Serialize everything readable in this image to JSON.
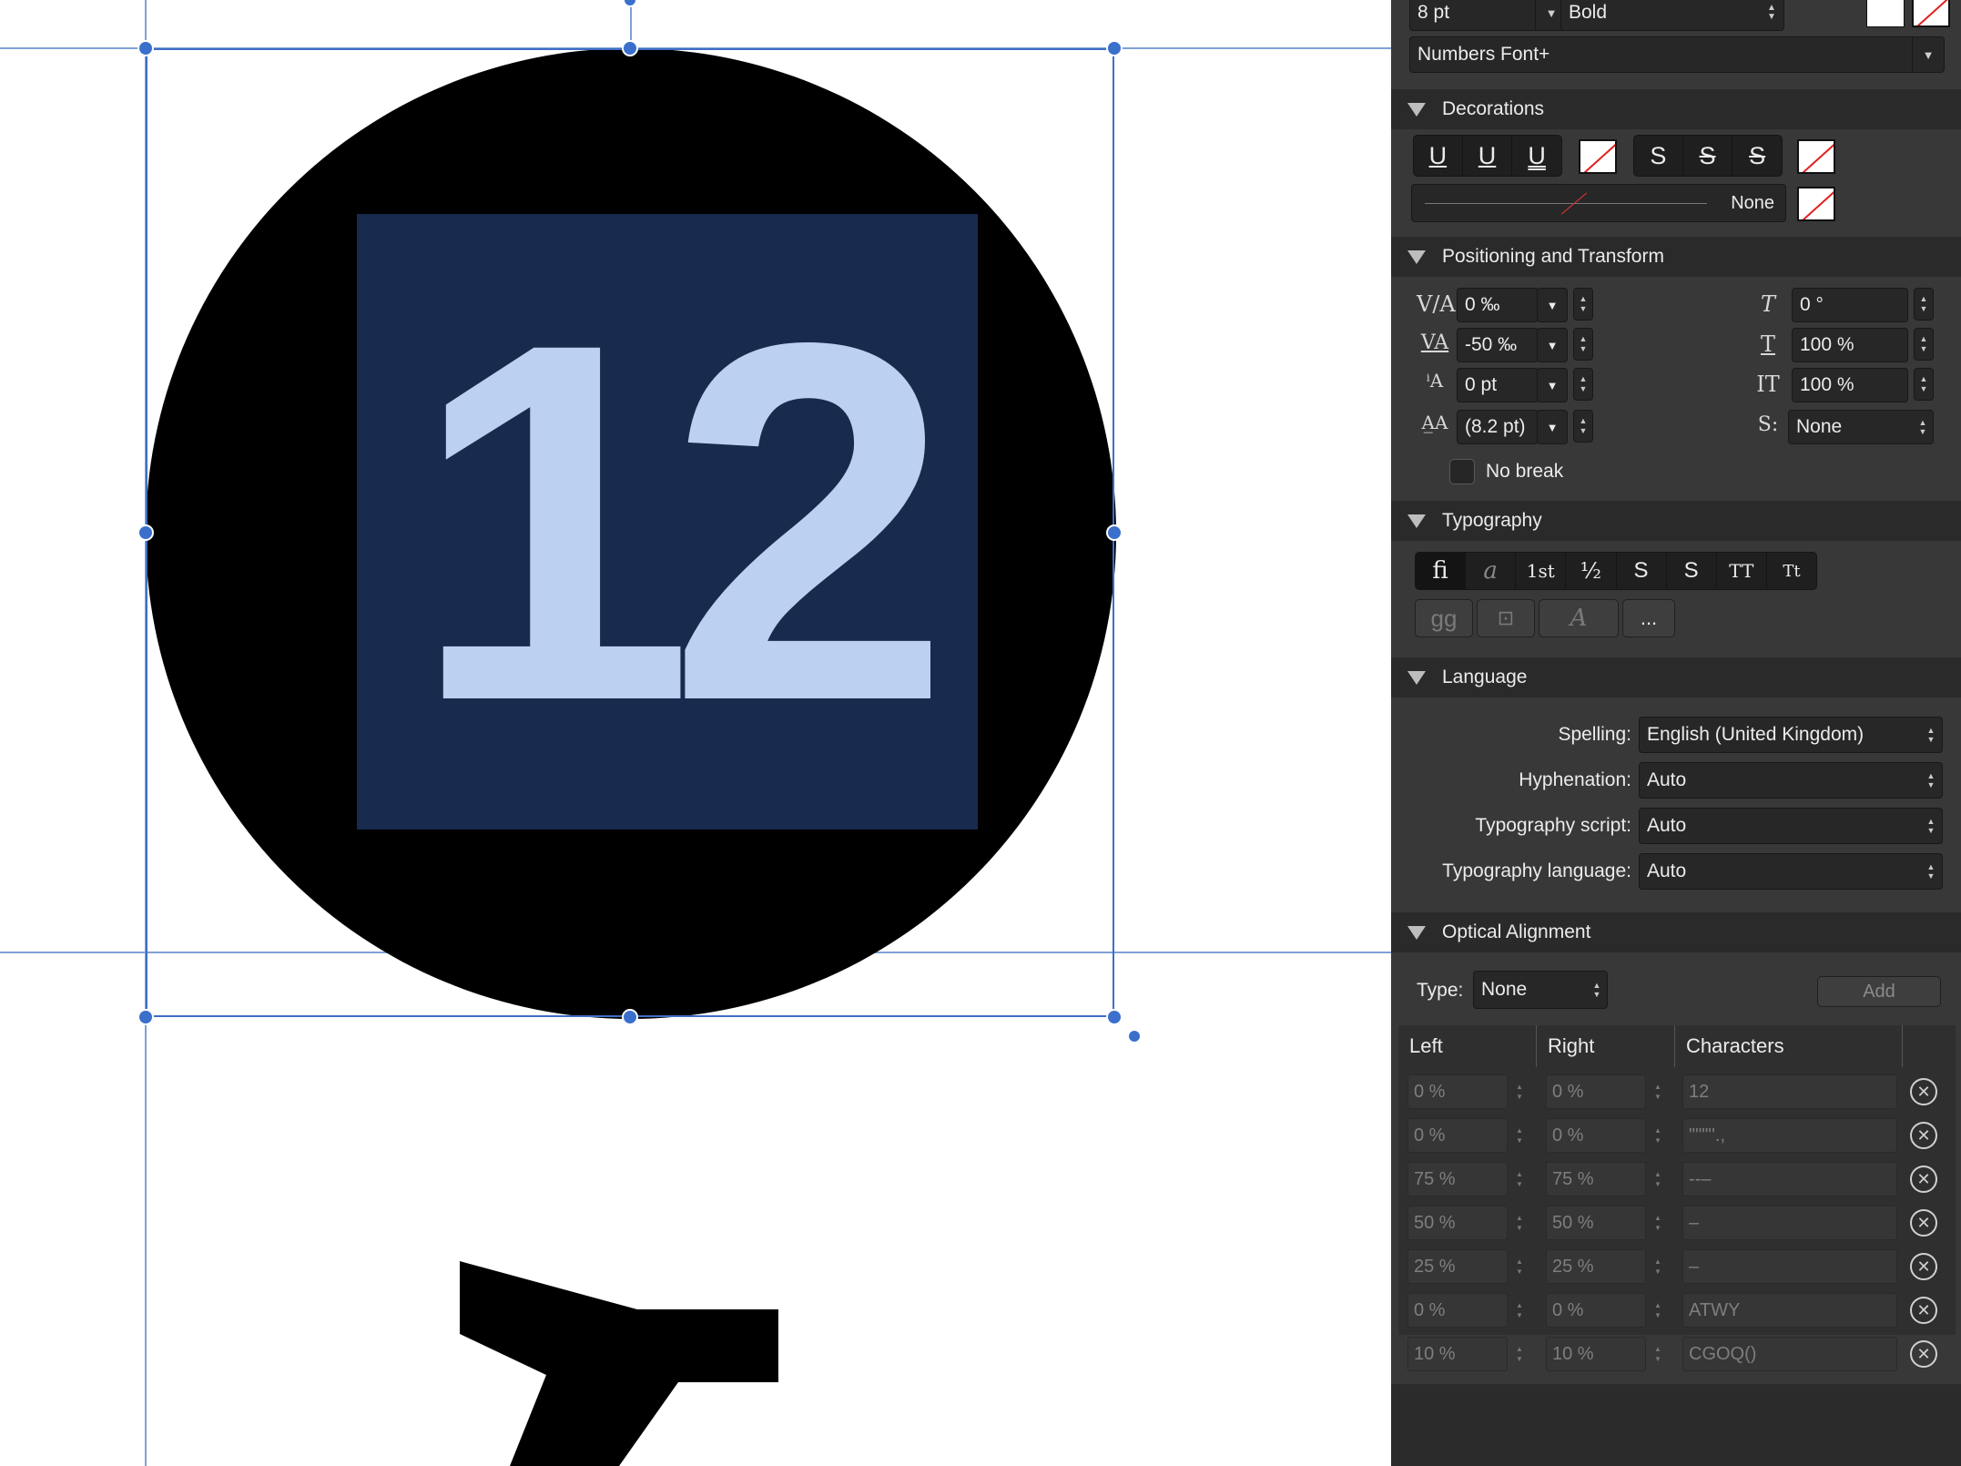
{
  "canvas": {
    "number_text": "12",
    "colors": {
      "circle": "#000000",
      "square": "#182a4d",
      "digits": "#bcd0f2",
      "guides": "#7fa0d6",
      "selection": "#3d6fc4"
    }
  },
  "panel": {
    "font_size": "8 pt",
    "font_weight": "Bold",
    "font_feature": "Numbers Font+",
    "decorations": {
      "title": "Decorations",
      "underline_buttons": [
        "U",
        "U",
        "U"
      ],
      "strike_buttons": [
        "S",
        "S",
        "S"
      ],
      "line_style": "None"
    },
    "positioning": {
      "title": "Positioning and Transform",
      "tracking": "0 ‰",
      "kerning": "-50 ‰",
      "baseline": "0 pt",
      "leading": "(8.2 pt)",
      "shear": "0 °",
      "vertical_scale": "100 %",
      "horizontal_scale": "100 %",
      "style_set": "None",
      "no_break": "No break"
    },
    "typography": {
      "title": "Typography",
      "buttons": [
        "fi",
        "a",
        "1st",
        "½",
        "S",
        "S",
        "TT",
        "Tt"
      ],
      "more": "..."
    },
    "language": {
      "title": "Language",
      "spelling_label": "Spelling:",
      "spelling_value": "English (United Kingdom)",
      "hyphenation_label": "Hyphenation:",
      "hyphenation_value": "Auto",
      "script_label": "Typography script:",
      "script_value": "Auto",
      "language_label": "Typography language:",
      "language_value": "Auto"
    },
    "optical": {
      "title": "Optical Alignment",
      "type_label": "Type:",
      "type_value": "None",
      "add_label": "Add",
      "columns": [
        "Left",
        "Right",
        "Characters"
      ],
      "rows": [
        {
          "left": "0 %",
          "right": "0 %",
          "chars": "12"
        },
        {
          "left": "0 %",
          "right": "0 %",
          "chars": "\"\"\"''.,"
        },
        {
          "left": "75 %",
          "right": "75 %",
          "chars": "--–"
        },
        {
          "left": "50 %",
          "right": "50 %",
          "chars": "–"
        },
        {
          "left": "25 %",
          "right": "25 %",
          "chars": "–"
        },
        {
          "left": "0 %",
          "right": "0 %",
          "chars": "ATWY"
        },
        {
          "left": "10 %",
          "right": "10 %",
          "chars": "CGOQ()"
        }
      ]
    }
  }
}
